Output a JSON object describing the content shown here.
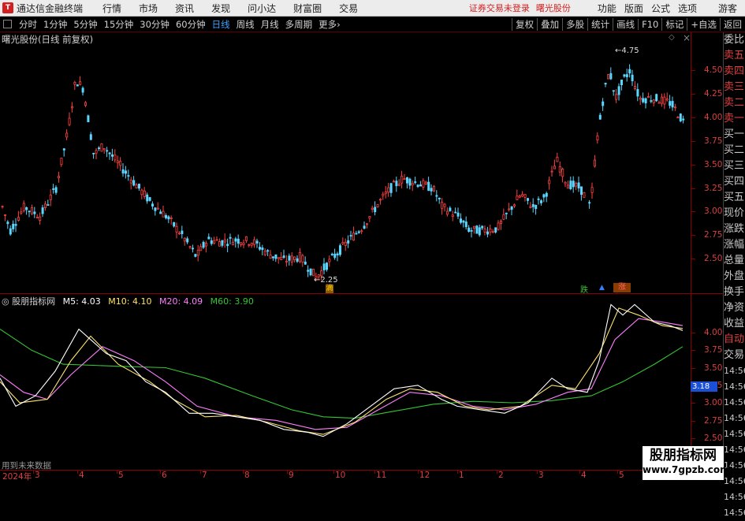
{
  "menubar": {
    "app_name": "通达信金融终端",
    "items": [
      "行情",
      "市场",
      "资讯",
      "发现",
      "问小达",
      "财富圈",
      "交易"
    ],
    "notice": "证券交易未登录",
    "stock": "曙光股份",
    "right_items": [
      "功能",
      "版面",
      "公式",
      "选项"
    ],
    "guest": "游客"
  },
  "toolbar": {
    "periods": [
      "分时",
      "1分钟",
      "5分钟",
      "15分钟",
      "30分钟",
      "60分钟",
      "日线",
      "周线",
      "月线",
      "多周期",
      "更多"
    ],
    "active": "日线",
    "right_buttons": [
      "复权",
      "叠加",
      "多股",
      "统计",
      "画线",
      "F10",
      "标记",
      "+自选",
      "返回"
    ]
  },
  "main_chart": {
    "title": "曙光股份(日线 前复权)",
    "y_ticks": [
      "4.50",
      "4.25",
      "4.00",
      "3.75",
      "3.50",
      "3.25",
      "3.00",
      "2.75",
      "2.50"
    ],
    "high_label": "4.75",
    "low_label": "2.25",
    "markers": [
      "跌",
      "涨"
    ]
  },
  "indicator": {
    "name": "股朋指标网",
    "m5": "M5: 4.03",
    "m10": "M10: 4.10",
    "m20": "M20: 4.09",
    "m60": "M60: 3.90",
    "y_ticks": [
      "4.00",
      "3.75",
      "3.50",
      "3.25",
      "3.00",
      "2.75",
      "2.50"
    ],
    "current_value": "3.18",
    "footnote": "用到未来数据",
    "colors": {
      "m5": "#ffffff",
      "m10": "#ffe36e",
      "m20": "#ff7eff",
      "m60": "#34c534"
    }
  },
  "date_axis": {
    "year": "2024年",
    "months": [
      "3",
      "4",
      "5",
      "6",
      "7",
      "8",
      "9",
      "10",
      "11",
      "12",
      "1",
      "2",
      "3",
      "4",
      "5",
      "6"
    ]
  },
  "side_panel": {
    "items": [
      "委比",
      "卖五",
      "卖四",
      "卖三",
      "卖二",
      "卖一",
      "买一",
      "买二",
      "买三",
      "买四",
      "买五",
      "现价",
      "涨跌",
      "涨幅",
      "总量",
      "外盘",
      "换手",
      "净资",
      "收益",
      "自动",
      "交易",
      "14:56",
      "14:56",
      "14:56",
      "14:56",
      "14:56",
      "14:56",
      "14:56",
      "14:56",
      "14:56",
      "14:56"
    ]
  },
  "watermark": {
    "site_cn": "股朋指标网",
    "site_url": "www.7gpzb.com"
  }
}
